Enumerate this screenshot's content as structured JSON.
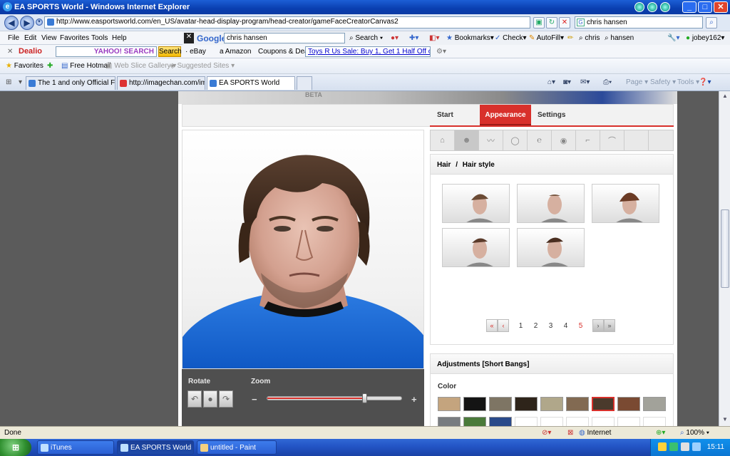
{
  "window": {
    "title": "EA SPORTS World - Windows Internet Explorer"
  },
  "address_bar": {
    "url": "http://www.easportsworld.com/en_US/avatar-head-display-program/head-creator/gameFaceCreatorCanvas2"
  },
  "search_box": {
    "value": "chris hansen"
  },
  "menu": [
    "File",
    "Edit",
    "View",
    "Favorites",
    "Tools",
    "Help"
  ],
  "google_bar": {
    "logo": "Google",
    "query": "chris hansen",
    "search_label": "Search",
    "bookmarks_label": "Bookmarks",
    "check_label": "Check",
    "autofill_label": "AutoFill",
    "chris_label": "chris",
    "hansen_label": "hansen",
    "user_label": "jobey162"
  },
  "dealio_bar": {
    "logo": "Dealio",
    "search_placeholder": "YAHOO! SEARCH",
    "search_button": "Search",
    "links": [
      "eBay",
      "Amazon",
      "Coupons & Deals"
    ],
    "ad_text": "Toys R Us Sale: Buy 1, Get 1 Half Off on"
  },
  "favorites_bar": {
    "favorites_label": "Favorites",
    "items": [
      "Free Hotmail",
      "Web Slice Gallery",
      "Suggested Sites"
    ]
  },
  "tabs": [
    {
      "label": "The 1 and only Official FIFA t..."
    },
    {
      "label": "http://imagechan.com/image..."
    },
    {
      "label": "EA SPORTS World"
    }
  ],
  "command_bar": [
    "Page",
    "Safety",
    "Tools"
  ],
  "page": {
    "hero_beta": "BETA",
    "nav": {
      "start": "Start",
      "appearance": "Appearance",
      "settings": "Settings"
    },
    "controls": {
      "rotate": "Rotate",
      "zoom": "Zoom",
      "minus": "−",
      "plus": "+",
      "zoom_level": 0.72
    },
    "hair_panel": {
      "section": "Hair",
      "separator": "/",
      "subsection": "Hair style"
    },
    "pagination": {
      "pages": [
        "1",
        "2",
        "3",
        "4",
        "5"
      ],
      "current": "5",
      "first": "«",
      "prev": "‹",
      "next": "›",
      "last": "»"
    },
    "adjustments": {
      "title": "Adjustments [Short Bangs]",
      "color_label": "Color",
      "swatches": [
        "#c4a47e",
        "#141414",
        "#7e7564",
        "#2e241a",
        "#b0a78a",
        "#826a52",
        "#4a3a2c",
        "#7a4a32",
        "#a2a29a",
        "#787c80",
        "#4a7a3a",
        "#2a4a8a",
        "#ffffff",
        "#ffffff",
        "#ffffff",
        "#ffffff",
        "#ffffff",
        "#ffffff"
      ],
      "selected_swatch": 6
    }
  },
  "status_bar": {
    "status": "Done",
    "zone": "Internet",
    "zoom": "100%"
  },
  "taskbar": {
    "items": [
      {
        "label": "iTunes"
      },
      {
        "label": "EA SPORTS World - ..."
      },
      {
        "label": "untitled - Paint"
      }
    ],
    "clock": "15:11"
  }
}
